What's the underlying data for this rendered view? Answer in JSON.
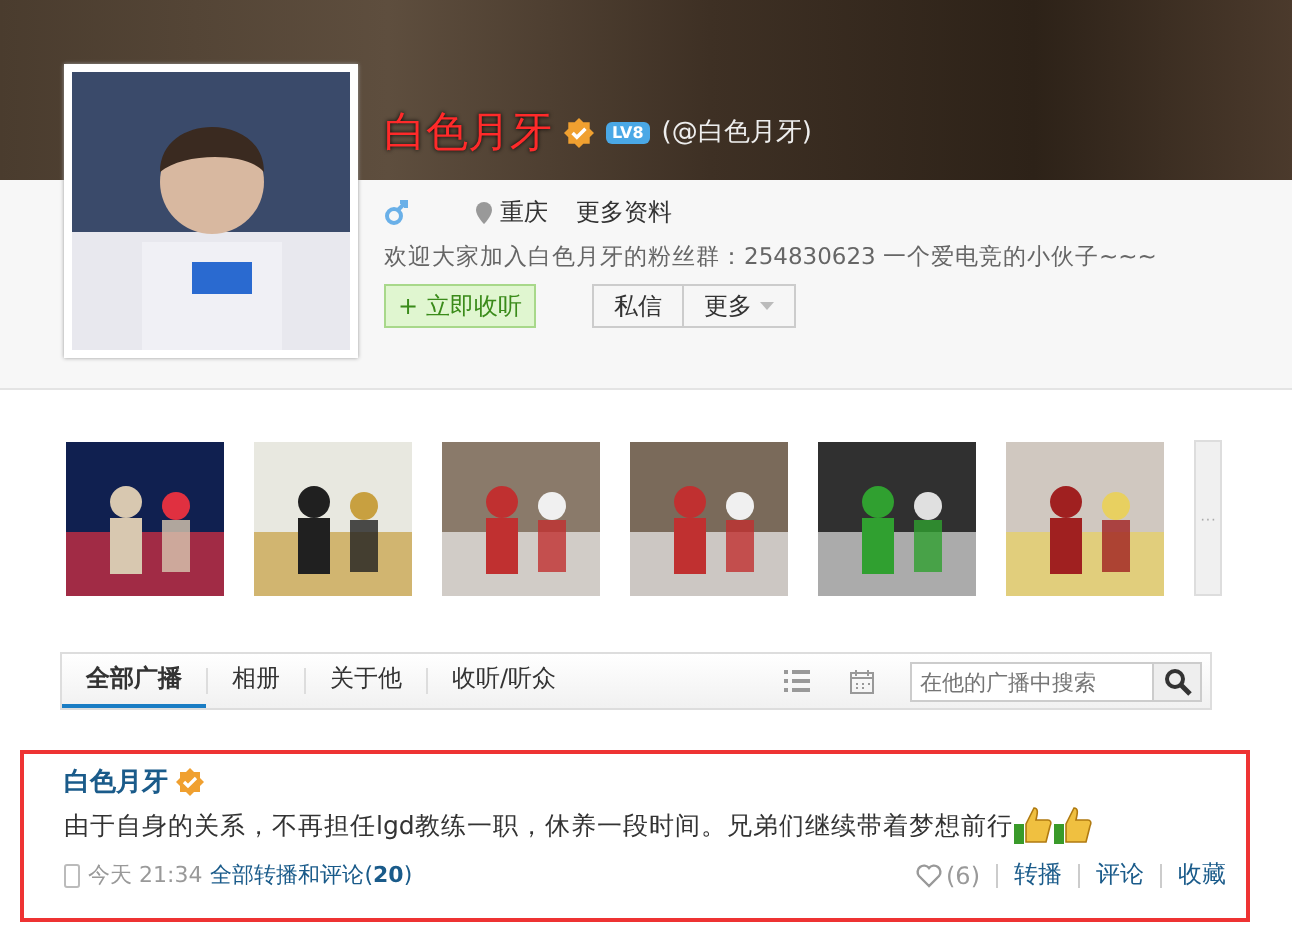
{
  "profile": {
    "name": "白色月牙",
    "level": "LV8",
    "handle": "(@白色月牙)",
    "location": "重庆",
    "more_info": "更多资料",
    "bio": "欢迎大家加入白色月牙的粉丝群：254830623 一个爱电竞的小伙子~~~",
    "follow_button": "+ 立即收听",
    "message_button": "私信",
    "more_button": "更多"
  },
  "photos_more": "···",
  "tabs": [
    {
      "label": "全部广播",
      "selected": true
    },
    {
      "label": "相册",
      "selected": false
    },
    {
      "label": "关于他",
      "selected": false
    },
    {
      "label": "收听/听众",
      "selected": false
    }
  ],
  "search": {
    "placeholder": "在他的广播中搜索"
  },
  "post": {
    "author": "白色月牙",
    "text": "由于自身的关系，不再担任lgd教练一职，休养一段时间。兄弟们继续带着梦想前行",
    "time": "今天 21:34",
    "comments_link": "全部转播和评论(**20**)",
    "likes": "(6)",
    "actions": [
      "转播",
      "评论",
      "收藏"
    ]
  }
}
